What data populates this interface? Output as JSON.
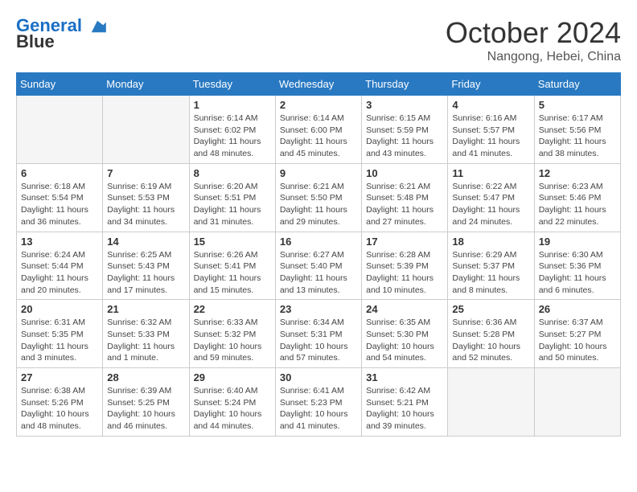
{
  "logo": {
    "line1": "General",
    "line2": "Blue"
  },
  "title": "October 2024",
  "location": "Nangong, Hebei, China",
  "days_of_week": [
    "Sunday",
    "Monday",
    "Tuesday",
    "Wednesday",
    "Thursday",
    "Friday",
    "Saturday"
  ],
  "weeks": [
    [
      {
        "day": "",
        "info": ""
      },
      {
        "day": "",
        "info": ""
      },
      {
        "day": "1",
        "info": "Sunrise: 6:14 AM\nSunset: 6:02 PM\nDaylight: 11 hours and 48 minutes."
      },
      {
        "day": "2",
        "info": "Sunrise: 6:14 AM\nSunset: 6:00 PM\nDaylight: 11 hours and 45 minutes."
      },
      {
        "day": "3",
        "info": "Sunrise: 6:15 AM\nSunset: 5:59 PM\nDaylight: 11 hours and 43 minutes."
      },
      {
        "day": "4",
        "info": "Sunrise: 6:16 AM\nSunset: 5:57 PM\nDaylight: 11 hours and 41 minutes."
      },
      {
        "day": "5",
        "info": "Sunrise: 6:17 AM\nSunset: 5:56 PM\nDaylight: 11 hours and 38 minutes."
      }
    ],
    [
      {
        "day": "6",
        "info": "Sunrise: 6:18 AM\nSunset: 5:54 PM\nDaylight: 11 hours and 36 minutes."
      },
      {
        "day": "7",
        "info": "Sunrise: 6:19 AM\nSunset: 5:53 PM\nDaylight: 11 hours and 34 minutes."
      },
      {
        "day": "8",
        "info": "Sunrise: 6:20 AM\nSunset: 5:51 PM\nDaylight: 11 hours and 31 minutes."
      },
      {
        "day": "9",
        "info": "Sunrise: 6:21 AM\nSunset: 5:50 PM\nDaylight: 11 hours and 29 minutes."
      },
      {
        "day": "10",
        "info": "Sunrise: 6:21 AM\nSunset: 5:48 PM\nDaylight: 11 hours and 27 minutes."
      },
      {
        "day": "11",
        "info": "Sunrise: 6:22 AM\nSunset: 5:47 PM\nDaylight: 11 hours and 24 minutes."
      },
      {
        "day": "12",
        "info": "Sunrise: 6:23 AM\nSunset: 5:46 PM\nDaylight: 11 hours and 22 minutes."
      }
    ],
    [
      {
        "day": "13",
        "info": "Sunrise: 6:24 AM\nSunset: 5:44 PM\nDaylight: 11 hours and 20 minutes."
      },
      {
        "day": "14",
        "info": "Sunrise: 6:25 AM\nSunset: 5:43 PM\nDaylight: 11 hours and 17 minutes."
      },
      {
        "day": "15",
        "info": "Sunrise: 6:26 AM\nSunset: 5:41 PM\nDaylight: 11 hours and 15 minutes."
      },
      {
        "day": "16",
        "info": "Sunrise: 6:27 AM\nSunset: 5:40 PM\nDaylight: 11 hours and 13 minutes."
      },
      {
        "day": "17",
        "info": "Sunrise: 6:28 AM\nSunset: 5:39 PM\nDaylight: 11 hours and 10 minutes."
      },
      {
        "day": "18",
        "info": "Sunrise: 6:29 AM\nSunset: 5:37 PM\nDaylight: 11 hours and 8 minutes."
      },
      {
        "day": "19",
        "info": "Sunrise: 6:30 AM\nSunset: 5:36 PM\nDaylight: 11 hours and 6 minutes."
      }
    ],
    [
      {
        "day": "20",
        "info": "Sunrise: 6:31 AM\nSunset: 5:35 PM\nDaylight: 11 hours and 3 minutes."
      },
      {
        "day": "21",
        "info": "Sunrise: 6:32 AM\nSunset: 5:33 PM\nDaylight: 11 hours and 1 minute."
      },
      {
        "day": "22",
        "info": "Sunrise: 6:33 AM\nSunset: 5:32 PM\nDaylight: 10 hours and 59 minutes."
      },
      {
        "day": "23",
        "info": "Sunrise: 6:34 AM\nSunset: 5:31 PM\nDaylight: 10 hours and 57 minutes."
      },
      {
        "day": "24",
        "info": "Sunrise: 6:35 AM\nSunset: 5:30 PM\nDaylight: 10 hours and 54 minutes."
      },
      {
        "day": "25",
        "info": "Sunrise: 6:36 AM\nSunset: 5:28 PM\nDaylight: 10 hours and 52 minutes."
      },
      {
        "day": "26",
        "info": "Sunrise: 6:37 AM\nSunset: 5:27 PM\nDaylight: 10 hours and 50 minutes."
      }
    ],
    [
      {
        "day": "27",
        "info": "Sunrise: 6:38 AM\nSunset: 5:26 PM\nDaylight: 10 hours and 48 minutes."
      },
      {
        "day": "28",
        "info": "Sunrise: 6:39 AM\nSunset: 5:25 PM\nDaylight: 10 hours and 46 minutes."
      },
      {
        "day": "29",
        "info": "Sunrise: 6:40 AM\nSunset: 5:24 PM\nDaylight: 10 hours and 44 minutes."
      },
      {
        "day": "30",
        "info": "Sunrise: 6:41 AM\nSunset: 5:23 PM\nDaylight: 10 hours and 41 minutes."
      },
      {
        "day": "31",
        "info": "Sunrise: 6:42 AM\nSunset: 5:21 PM\nDaylight: 10 hours and 39 minutes."
      },
      {
        "day": "",
        "info": ""
      },
      {
        "day": "",
        "info": ""
      }
    ]
  ]
}
